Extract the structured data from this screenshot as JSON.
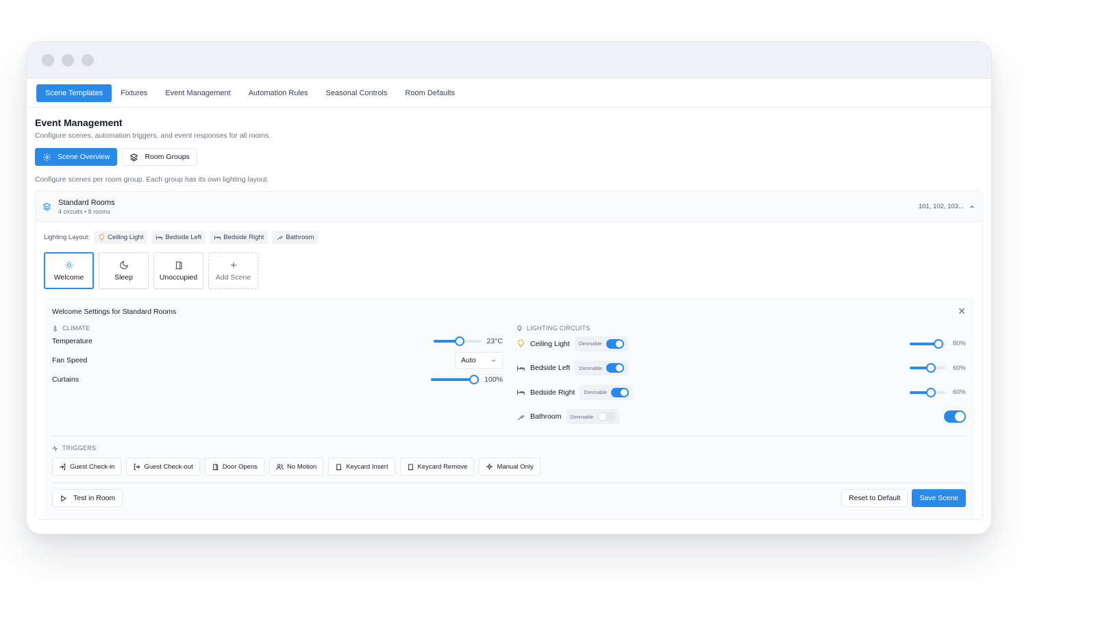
{
  "tabs": [
    {
      "label": "Scene Templates",
      "active": true
    },
    {
      "label": "Fixtures"
    },
    {
      "label": "Event Management"
    },
    {
      "label": "Automation Rules"
    },
    {
      "label": "Seasonal Controls"
    },
    {
      "label": "Room Defaults"
    }
  ],
  "page": {
    "title": "Event Management",
    "subtitle": "Configure scenes, automation triggers, and event responses for all rooms.",
    "view_overview": "Scene Overview",
    "view_groups": "Room Groups",
    "description": "Configure scenes per room group. Each group has its own lighting layout."
  },
  "group": {
    "name": "Standard Rooms",
    "meta": "4 circuits • 8 rooms",
    "rooms": "101, 102, 103...",
    "layout_label": "Lighting Layout:",
    "layout_chips": [
      "Ceiling Light",
      "Bedside Left",
      "Bedside Right",
      "Bathroom"
    ]
  },
  "scenes": [
    {
      "label": "Welcome",
      "icon": "sun-icon",
      "active": true
    },
    {
      "label": "Sleep",
      "icon": "moon-icon"
    },
    {
      "label": "Unoccupied",
      "icon": "door-icon"
    },
    {
      "label": "Add Scene",
      "icon": "plus-icon"
    }
  ],
  "settings": {
    "title": "Welcome Settings for Standard Rooms",
    "climate_label": "CLIMATE",
    "lighting_label": "LIGHTING CIRCUITS",
    "triggers_label": "TRIGGERS",
    "climate": {
      "temperature_label": "Temperature",
      "temperature_value": "23°C",
      "temperature_fraction": 0.55,
      "fan_label": "Fan Speed",
      "fan_value": "Auto",
      "curtains_label": "Curtains",
      "curtains_value": "100%",
      "curtains_fraction": 1.0
    },
    "circuits": [
      {
        "name": "Ceiling Light",
        "badge": "Dimmable",
        "on": true,
        "level": "80%",
        "fraction": 0.8
      },
      {
        "name": "Bedside Left",
        "badge": "Dimmable",
        "on": true,
        "level": "60%",
        "fraction": 0.6
      },
      {
        "name": "Bedside Right",
        "badge": "Dimmable",
        "on": true,
        "level": "60%",
        "fraction": 0.6
      },
      {
        "name": "Bathroom",
        "badge": "Dimmable",
        "on": false,
        "master_on": true
      }
    ],
    "triggers": [
      "Guest Check-in",
      "Guest Check-out",
      "Door Opens",
      "No Motion",
      "Keycard Insert",
      "Keycard Remove",
      "Manual Only"
    ],
    "test_label": "Test in Room",
    "reset_label": "Reset to Default",
    "save_label": "Save Scene"
  },
  "colors": {
    "accent": "#2b8ae6",
    "panel": "#f8fafc",
    "border": "#e5e7eb"
  }
}
